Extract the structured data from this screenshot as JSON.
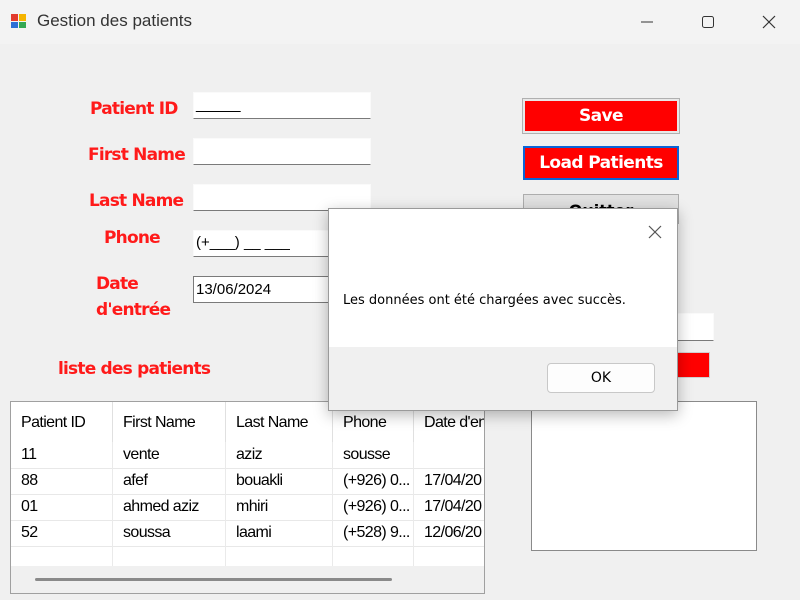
{
  "window": {
    "title": "Gestion des patients"
  },
  "form": {
    "labels": {
      "patient_id": "Patient ID",
      "first_name": "First Name",
      "last_name": "Last Name",
      "phone": "Phone",
      "date_line1": "Date",
      "date_line2": "d'entrée"
    },
    "fields": {
      "patient_id_mask": "_____",
      "first_name": "",
      "last_name": "",
      "phone_mask": "(+___) __ ___",
      "date": "13/06/2024"
    },
    "list_title": "liste des patients"
  },
  "buttons": {
    "save": "Save",
    "load": "Load Patients",
    "quit": "Quitter"
  },
  "table": {
    "columns": [
      "Patient ID",
      "First Name",
      "Last Name",
      "Phone",
      "Date d'en"
    ],
    "rows": [
      [
        "11",
        "vente",
        "aziz",
        "sousse",
        ""
      ],
      [
        "88",
        "afef",
        "bouakli",
        "(+926) 0...",
        "17/04/20"
      ],
      [
        "01",
        "ahmed aziz",
        "mhiri",
        "(+926) 0...",
        "17/04/20"
      ],
      [
        "52",
        "soussa",
        "laami",
        "(+528) 9...",
        "12/06/20"
      ]
    ]
  },
  "dialog": {
    "message": "Les données ont été chargées avec succès.",
    "ok": "OK"
  },
  "colors": {
    "label_red": "#ff1a1a",
    "button_red": "#ff0000",
    "focus_blue": "#0a64d8"
  }
}
